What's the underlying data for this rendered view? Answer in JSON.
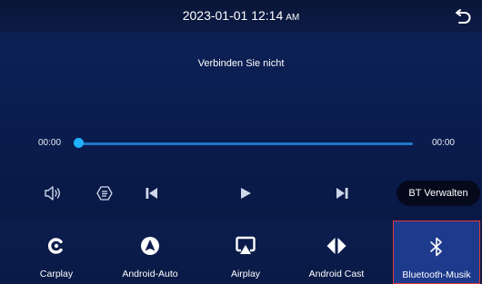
{
  "status_bar": {
    "datetime": "2023-01-01 12:14",
    "ampm": "AM"
  },
  "player": {
    "title": "Verbinden Sie nicht",
    "time_elapsed": "00:00",
    "time_total": "00:00",
    "progress_fraction": 0
  },
  "controls": {
    "volume_icon": "volume-icon",
    "playlist_icon": "playlist-icon",
    "previous_icon": "skip-previous-icon",
    "play_icon": "play-icon",
    "next_icon": "skip-next-icon",
    "bt_manage_label": "BT Verwalten"
  },
  "dock": {
    "items": [
      {
        "label": "Carplay",
        "icon": "carplay-icon"
      },
      {
        "label": "Android-Auto",
        "icon": "android-auto-icon"
      },
      {
        "label": "Airplay",
        "icon": "airplay-icon"
      },
      {
        "label": "Android Cast",
        "icon": "android-cast-icon"
      },
      {
        "label": "Bluetooth-Musik",
        "icon": "bluetooth-icon",
        "active": true
      }
    ]
  },
  "colors": {
    "accent": "#1fb0ff",
    "progress": "#1f77c8",
    "active_border": "#e03a3a"
  }
}
